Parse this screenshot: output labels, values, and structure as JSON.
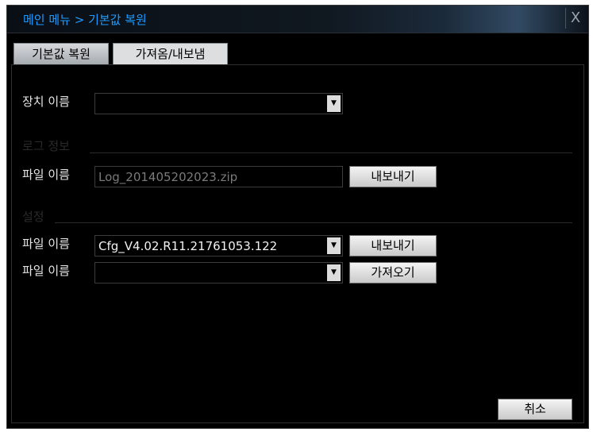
{
  "window": {
    "title": "메인 메뉴 > 기본값 복원",
    "close_label": "X"
  },
  "tabs": [
    {
      "label": "기본값 복원",
      "active": false
    },
    {
      "label": "가져옴/내보냄",
      "active": true
    }
  ],
  "device": {
    "label": "장치 이름",
    "value": ""
  },
  "log_info": {
    "section_title": "로그 정보",
    "file_label": "파일 이름",
    "file_value": "Log_201405202023.zip",
    "export_button": "내보내기"
  },
  "settings": {
    "section_title": "설정",
    "export_row": {
      "file_label": "파일 이름",
      "file_value": "Cfg_V4.02.R11.21761053.122",
      "button": "내보내기"
    },
    "import_row": {
      "file_label": "파일 이름",
      "file_value": "",
      "button": "가져오기"
    }
  },
  "footer": {
    "cancel_button": "취소"
  }
}
